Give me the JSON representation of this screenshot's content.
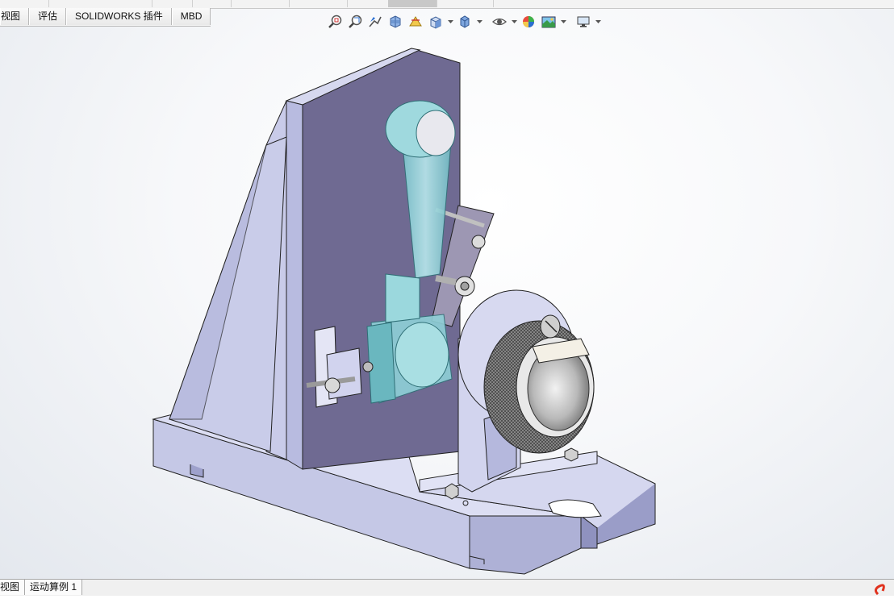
{
  "command_tabs": [
    {
      "label": "视图"
    },
    {
      "label": "评估"
    },
    {
      "label": "SOLIDWORKS 插件"
    },
    {
      "label": "MBD"
    }
  ],
  "heads_up_toolbar": [
    {
      "icon": "zoom-to-fit-icon"
    },
    {
      "icon": "zoom-to-area-icon"
    },
    {
      "icon": "previous-view-icon"
    },
    {
      "icon": "section-view-icon"
    },
    {
      "icon": "dynamic-annotation-views-icon"
    },
    {
      "icon": "view-orientation-icon",
      "dropdown": true
    },
    {
      "icon": "display-style-icon",
      "dropdown": true
    },
    {
      "icon": "hide-show-items-icon",
      "dropdown": true
    },
    {
      "icon": "edit-appearance-icon"
    },
    {
      "icon": "apply-scene-icon",
      "dropdown": true
    },
    {
      "icon": "view-settings-icon",
      "dropdown": true
    }
  ],
  "bottom_tabs": [
    {
      "label": "视图"
    },
    {
      "label": "运动算例 1"
    }
  ],
  "colors": {
    "fixture_body": "#b9bcdf",
    "fixture_face": "#ced0ec",
    "fixture_dark": "#7d789f",
    "connecting_rod": "#9ad6dc",
    "viewport_bg": "#eef1f5",
    "brand_accent": "#e0321e"
  }
}
